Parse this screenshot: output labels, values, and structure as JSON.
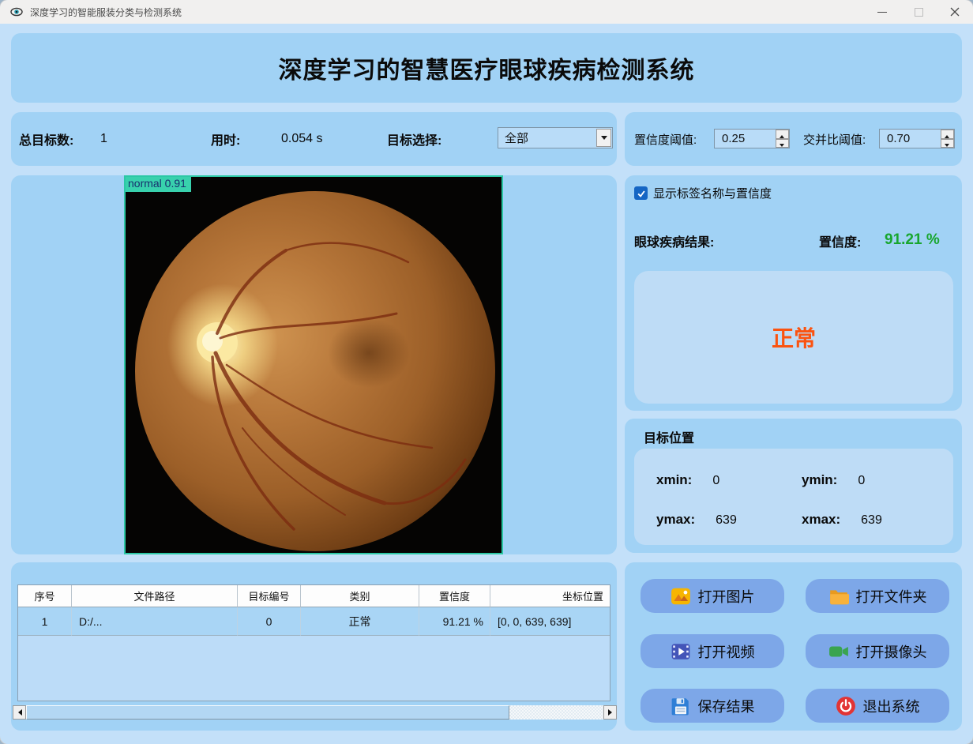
{
  "window": {
    "title": "深度学习的智能服装分类与检测系统"
  },
  "header": {
    "title": "深度学习的智慧医疗眼球疾病检测系统"
  },
  "toolbar": {
    "total_label": "总目标数:",
    "total_value": "1",
    "time_label": "用时:",
    "time_value": "0.054 s",
    "select_label": "目标选择:",
    "select_value": "全部",
    "conf_label": "置信度阈值:",
    "conf_value": "0.25",
    "iou_label": "交并比阈值:",
    "iou_value": "0.70"
  },
  "viewer": {
    "bbox_label": "normal 0.91"
  },
  "result": {
    "show_labels_checkbox": "显示标签名称与置信度",
    "disease_label": "眼球疾病结果:",
    "confidence_label": "置信度:",
    "confidence_value": "91.21 %",
    "class_name": "正常"
  },
  "position": {
    "title": "目标位置",
    "xmin_label": "xmin:",
    "xmin_value": "0",
    "ymin_label": "ymin:",
    "ymin_value": "0",
    "ymax_label": "ymax:",
    "ymax_value": "639",
    "xmax_label": "xmax:",
    "xmax_value": "639"
  },
  "buttons": [
    {
      "name": "open-image",
      "icon": "image-icon",
      "label": "打开图片"
    },
    {
      "name": "open-folder",
      "icon": "folder-icon",
      "label": "打开文件夹"
    },
    {
      "name": "open-video",
      "icon": "video-icon",
      "label": "打开视频"
    },
    {
      "name": "open-camera",
      "icon": "camera-icon",
      "label": "打开摄像头"
    },
    {
      "name": "save-results",
      "icon": "save-icon",
      "label": "保存结果"
    },
    {
      "name": "exit-system",
      "icon": "power-icon",
      "label": "退出系统"
    }
  ],
  "table": {
    "headers": [
      "序号",
      "文件路径",
      "目标编号",
      "类别",
      "置信度",
      "坐标位置"
    ],
    "rows": [
      [
        "1",
        "D:/...",
        "0",
        "正常",
        "91.21 %",
        "[0, 0, 639, 639]"
      ]
    ]
  },
  "colors": {
    "bbox_teal": "#2cc8a5",
    "confidence_green": "#18a62e",
    "result_orange": "#fb5310",
    "panel_blue": "#a1d2f5",
    "button_blue": "#7da7e8",
    "checkbox_blue": "#1566c4"
  }
}
